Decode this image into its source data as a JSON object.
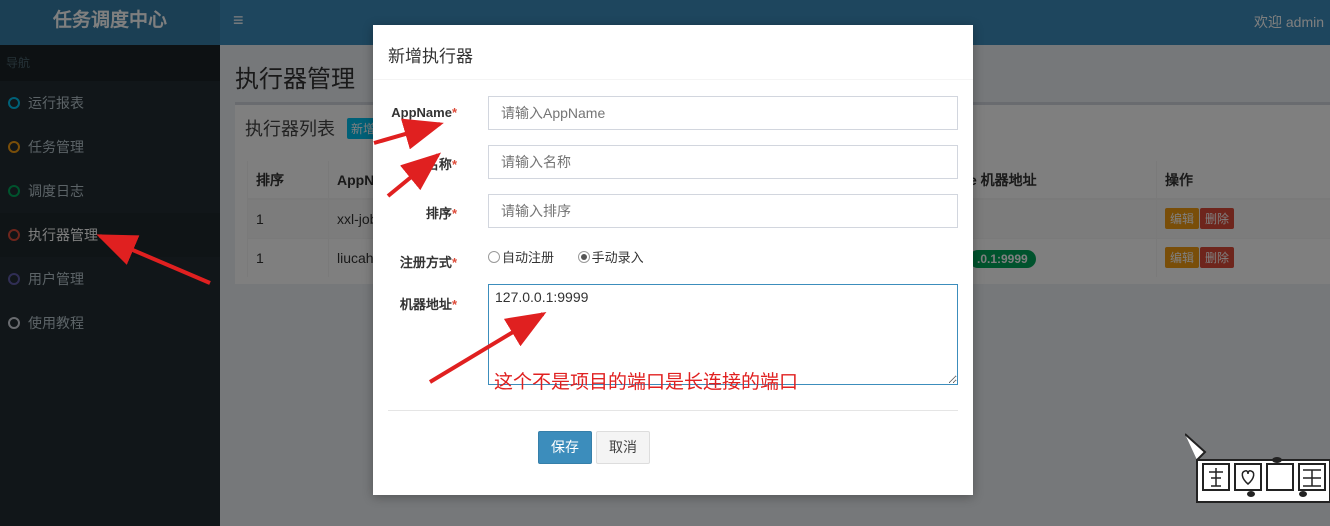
{
  "header": {
    "logo": "任务调度中心",
    "menu_toggle": "≡",
    "welcome": "欢迎 admin"
  },
  "sidebar": {
    "header": "导航",
    "items": [
      {
        "label": "运行报表",
        "color": "#00c0ef"
      },
      {
        "label": "任务管理",
        "color": "#f39c12"
      },
      {
        "label": "调度日志",
        "color": "#00a65a"
      },
      {
        "label": "执行器管理",
        "color": "#dd4b39"
      },
      {
        "label": "用户管理",
        "color": "#605ca8"
      },
      {
        "label": "使用教程",
        "color": "#d2d6de"
      }
    ]
  },
  "main": {
    "page_title": "执行器管理",
    "box_title": "执行器列表",
    "add_button": "新增",
    "table": {
      "headers": [
        "排序",
        "AppN",
        "e 机器地址",
        "操作"
      ],
      "rows": [
        {
          "order": "1",
          "app": "xxl-job",
          "address": "",
          "edit": "编辑",
          "delete": "删除"
        },
        {
          "order": "1",
          "app": "liucah",
          "address": ".0.1:9999",
          "edit": "编辑",
          "delete": "删除"
        }
      ]
    }
  },
  "modal": {
    "title": "新增执行器",
    "fields": {
      "appname": {
        "label": "AppName",
        "placeholder": "请输入AppName"
      },
      "name": {
        "label": "名称",
        "placeholder": "请输入名称"
      },
      "order": {
        "label": "排序",
        "placeholder": "请输入排序"
      },
      "register_type": {
        "label": "注册方式",
        "options": [
          "自动注册",
          "手动录入"
        ],
        "selected": "手动录入"
      },
      "address": {
        "label": "机器地址",
        "value": "127.0.0.1:9999"
      }
    },
    "required_mark": "*",
    "annotation": "这个不是项目的端口是长连接的端口",
    "save": "保存",
    "cancel": "取消"
  },
  "colors": {
    "header": "#3c8dbc",
    "sidebar": "#222d32",
    "annotation": "#e02020"
  }
}
